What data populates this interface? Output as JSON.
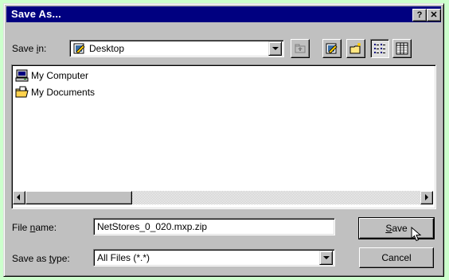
{
  "window": {
    "title": "Save As...",
    "help_label": "?",
    "close_label": "✕"
  },
  "save_in": {
    "label_prefix": "Save ",
    "label_accel": "i",
    "label_suffix": "n:",
    "selected": "Desktop",
    "selected_icon": "desktop-icon"
  },
  "toolbar": {
    "buttons": [
      "up-one-level-icon",
      "desktop-icon",
      "create-new-folder-icon",
      "list-view-icon",
      "details-view-icon"
    ]
  },
  "file_list": {
    "items": [
      {
        "label": "My Computer",
        "icon": "my-computer-icon"
      },
      {
        "label": "My Documents",
        "icon": "folder-icon"
      }
    ]
  },
  "file_name": {
    "label_prefix": "File ",
    "label_accel": "n",
    "label_suffix": "ame:",
    "value": "NetStores_0_020.mxp.zip"
  },
  "save_as_type": {
    "label_prefix": "Save as ",
    "label_accel": "t",
    "label_suffix": "ype:",
    "value": "All Files (*.*)"
  },
  "buttons": {
    "save_accel": "S",
    "save_rest": "ave",
    "cancel": "Cancel"
  },
  "colors": {
    "background": "#ccffcc",
    "titlebar": "#000080",
    "face": "#c0c0c0"
  }
}
